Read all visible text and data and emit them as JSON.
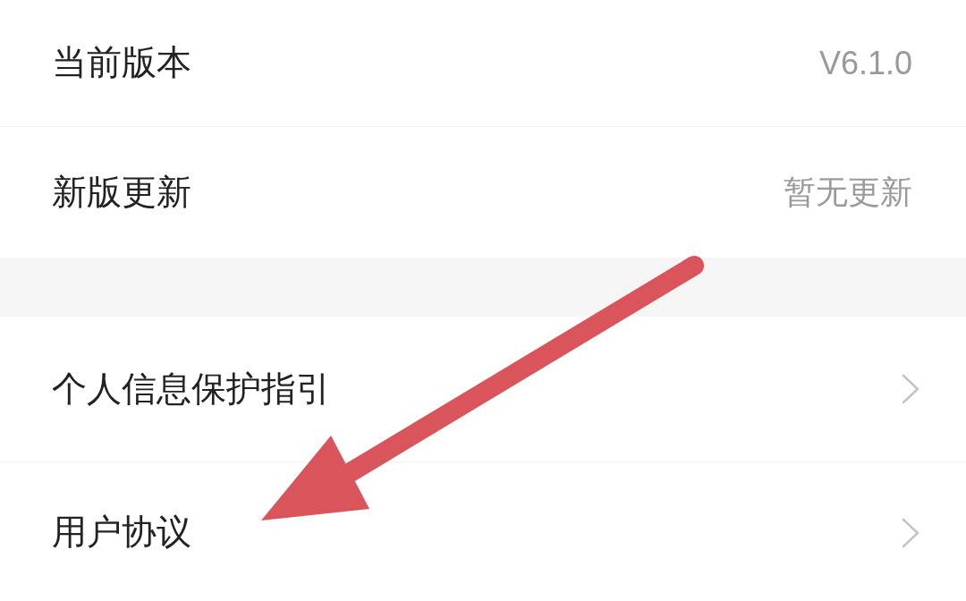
{
  "sections": [
    {
      "items": [
        {
          "kind": "value",
          "label": "当前版本",
          "value": "V6.1.0"
        },
        {
          "kind": "value",
          "label": "新版更新",
          "value": "暂无更新"
        }
      ]
    },
    {
      "items": [
        {
          "kind": "link",
          "label": "个人信息保护指引"
        },
        {
          "kind": "link",
          "label": "用户协议"
        }
      ]
    }
  ],
  "annotation": {
    "kind": "arrow"
  }
}
